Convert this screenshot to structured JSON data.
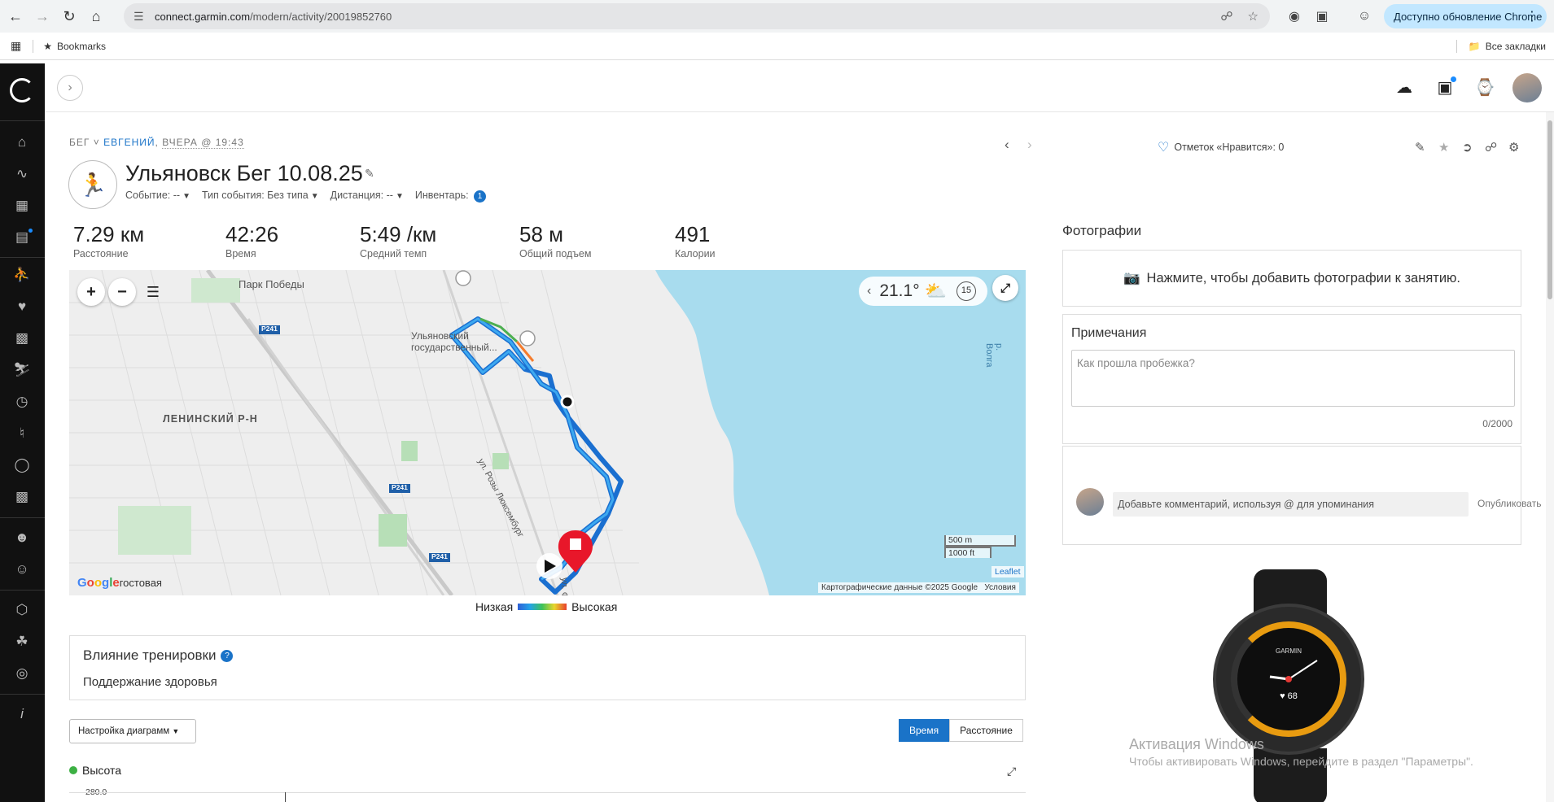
{
  "browser": {
    "url_host": "connect.garmin.com",
    "url_path": "/modern/activity/20019852760",
    "update_label": "Доступно обновление Chrome",
    "bookmarks_label": "Bookmarks",
    "all_bookmarks_label": "Все закладки"
  },
  "activity": {
    "type_label": "БЕГ",
    "user": "ЕВГЕНИЙ",
    "when": "ВЧЕРА @ 19:43",
    "title": "Ульяновск Бег 10.08.25",
    "event_label": "Событие: --",
    "event_type_label": "Тип события: Без типа",
    "distance_meta_label": "Дистанция: --",
    "gear_label": "Инвентарь:",
    "gear_count": "1",
    "likes_label": "Отметок «Нравится»: 0"
  },
  "stats": [
    {
      "value": "7.29 км",
      "label": "Расстояние"
    },
    {
      "value": "42:26",
      "label": "Время"
    },
    {
      "value": "5:49 /км",
      "label": "Средний темп"
    },
    {
      "value": "58 м",
      "label": "Общий подъем"
    },
    {
      "value": "491",
      "label": "Калории"
    }
  ],
  "map": {
    "temperature": "21.1°",
    "wind": "15",
    "labels": {
      "park": "Парк Победы",
      "university": "Ульяновский государственный...",
      "district": "ЛЕНИНСКИЙ Р-Н",
      "street": "ул. Розы Люксембург",
      "street2": "ул. Ф",
      "river": "р. Волга",
      "road1": "P241",
      "road2": "P241",
      "road3": "P241",
      "google_suffix": "гостовая"
    },
    "scale_m": "500 m",
    "scale_ft": "1000 ft",
    "leaflet": "Leaflet",
    "attribution": "Картографические данные ©2025 Google",
    "terms": "Условия",
    "legend_low": "Низкая",
    "legend_high": "Высокая"
  },
  "training": {
    "heading": "Влияние тренировки",
    "help": "?",
    "value": "Поддержание здоровья"
  },
  "chart_controls": {
    "setup_label": "Настройка диаграмм",
    "time_label": "Время",
    "distance_label": "Расстояние",
    "series_label": "Высота",
    "y_tick": "280.0"
  },
  "right": {
    "photos_heading": "Фотографии",
    "photos_add": "Нажмите, чтобы добавить фотографии к занятию.",
    "notes_heading": "Примечания",
    "notes_placeholder": "Как прошла пробежка?",
    "notes_count": "0/2000",
    "comment_placeholder": "Добавьте комментарий, используя @ для упоминания",
    "publish_label": "Опубликовать"
  },
  "watch": {
    "brand": "GARMIN",
    "heart_rate": "♥ 68"
  },
  "windows": {
    "activation_title": "Активация Windows",
    "activation_text": "Чтобы активировать Windows, перейдите в раздел \"Параметры\"."
  }
}
